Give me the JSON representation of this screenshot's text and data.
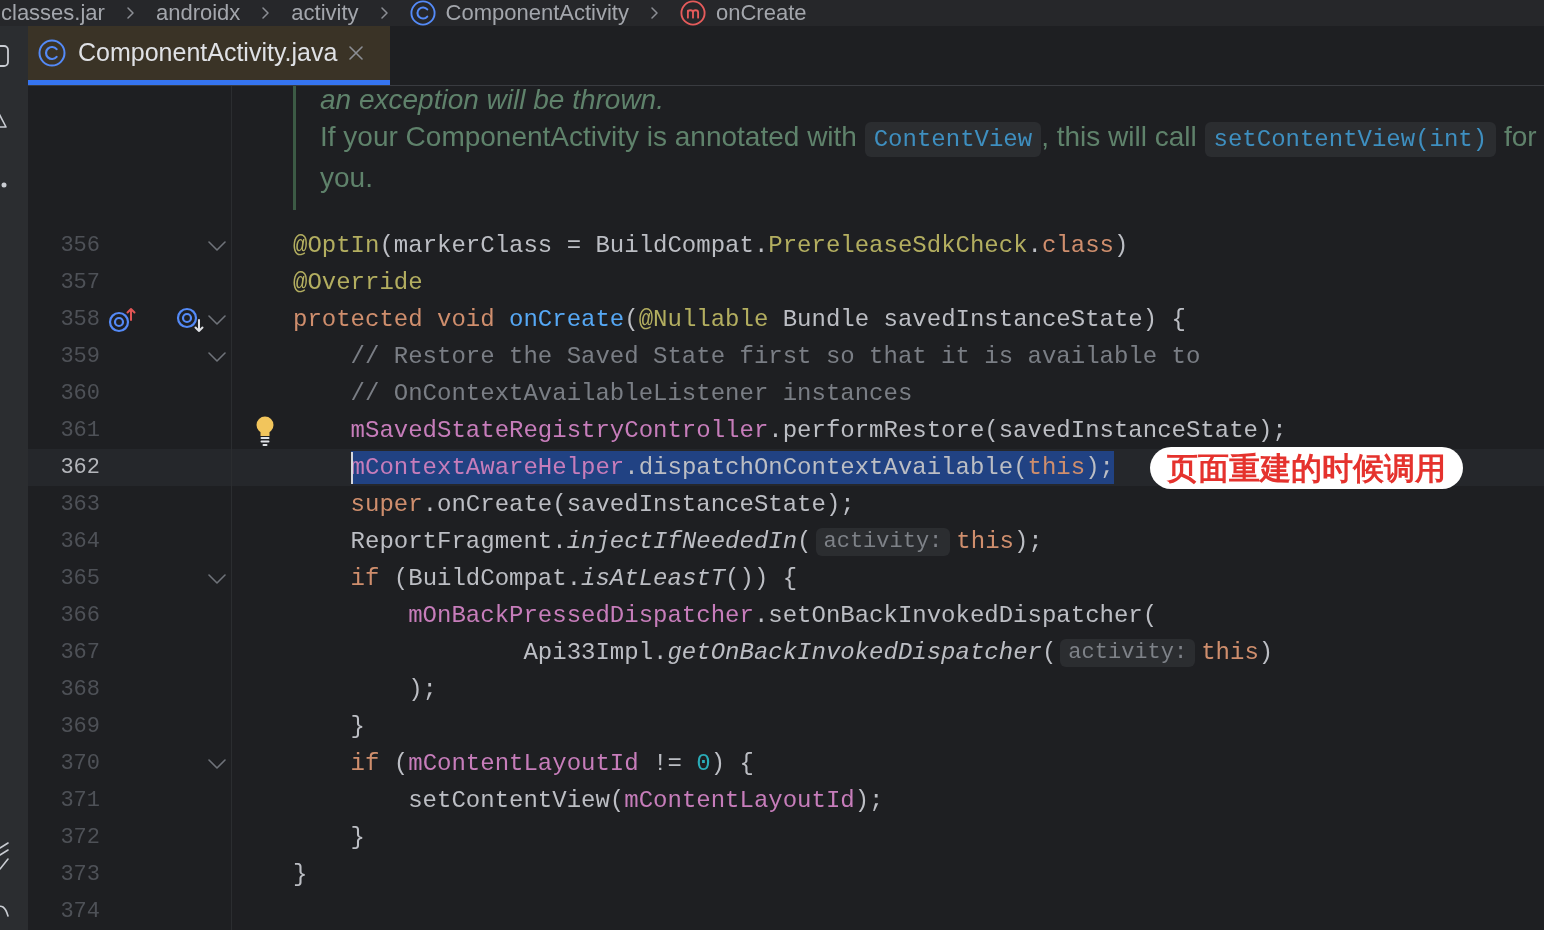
{
  "breadcrumbs": [
    {
      "label": "classes.jar",
      "kind": "plain"
    },
    {
      "label": "androidx",
      "kind": "plain"
    },
    {
      "label": "activity",
      "kind": "plain"
    },
    {
      "label": "ComponentActivity",
      "kind": "class"
    },
    {
      "label": "onCreate",
      "kind": "method"
    }
  ],
  "tabs": [
    {
      "label": "ComponentActivity.java",
      "kind": "class",
      "selected": true
    }
  ],
  "doc": {
    "fragment": "an exception will be thrown.",
    "paragraph": [
      {
        "kind": "text",
        "text": "If your ComponentActivity is annotated with "
      },
      {
        "kind": "code",
        "text": "ContentView"
      },
      {
        "kind": "text",
        "text": ", this will call "
      },
      {
        "kind": "code",
        "text": "setContentView(int)"
      },
      {
        "kind": "text",
        "text": " for you."
      }
    ]
  },
  "lines": [
    {
      "number": "356",
      "fold": true,
      "selected": false,
      "tokens": [
        {
          "text": "@OptIn",
          "kind": "annotation"
        },
        {
          "text": "(markerClass = BuildCompat.",
          "kind": "plain"
        },
        {
          "text": "PrereleaseSdkCheck",
          "kind": "annotation"
        },
        {
          "text": ".",
          "kind": "plain"
        },
        {
          "text": "class",
          "kind": "keyword"
        },
        {
          "text": ")",
          "kind": "plain"
        }
      ]
    },
    {
      "number": "357",
      "fold": false,
      "selected": false,
      "tokens": [
        {
          "text": "@Override",
          "kind": "annotation"
        }
      ]
    },
    {
      "number": "358",
      "fold": true,
      "selected": false,
      "markers": [
        {
          "kind": "ring-up"
        },
        {
          "kind": "ring-down"
        }
      ],
      "tokens": [
        {
          "text": "protected void ",
          "kind": "keyword"
        },
        {
          "text": "onCreate",
          "kind": "method"
        },
        {
          "text": "(",
          "kind": "plain"
        },
        {
          "text": "@Nullable",
          "kind": "annotation"
        },
        {
          "text": " Bundle savedInstanceState) {",
          "kind": "plain"
        }
      ]
    },
    {
      "number": "359",
      "fold": true,
      "selected": false,
      "tokens": [
        {
          "text": "    // Restore the Saved State first so that it is available to",
          "kind": "comment"
        }
      ]
    },
    {
      "number": "360",
      "fold": false,
      "selected": false,
      "tokens": [
        {
          "text": "    // OnContextAvailableListener instances",
          "kind": "comment"
        }
      ]
    },
    {
      "number": "361",
      "fold": false,
      "selected": false,
      "markers": [
        {
          "kind": "bulb"
        }
      ],
      "tokens": [
        {
          "text": "    mSavedStateRegistryController",
          "kind": "field"
        },
        {
          "text": ".performRestore(savedInstanceState);",
          "kind": "plain"
        }
      ]
    },
    {
      "number": "362",
      "fold": false,
      "selected": true,
      "callout": "页面重建的时候调用",
      "tokens": [
        {
          "text": "    mContextAwareHelper",
          "kind": "field"
        },
        {
          "text": ".dispatchOnContextAvailable(",
          "kind": "plain"
        },
        {
          "text": "this",
          "kind": "keyword"
        },
        {
          "text": ");",
          "kind": "plain"
        }
      ]
    },
    {
      "number": "363",
      "fold": false,
      "selected": false,
      "tokens": [
        {
          "text": "    super",
          "kind": "keyword"
        },
        {
          "text": ".onCreate(savedInstanceState);",
          "kind": "plain"
        }
      ]
    },
    {
      "number": "364",
      "fold": false,
      "selected": false,
      "tokens": [
        {
          "text": "    ReportFragment.",
          "kind": "plain"
        },
        {
          "text": "injectIfNeededIn",
          "kind": "static"
        },
        {
          "text": "(",
          "kind": "plain"
        },
        {
          "text": "activity:",
          "kind": "hint"
        },
        {
          "text": "this",
          "kind": "keyword"
        },
        {
          "text": ");",
          "kind": "plain"
        }
      ]
    },
    {
      "number": "365",
      "fold": true,
      "selected": false,
      "tokens": [
        {
          "text": "    if ",
          "kind": "keyword"
        },
        {
          "text": "(BuildCompat.",
          "kind": "plain"
        },
        {
          "text": "isAtLeastT",
          "kind": "static"
        },
        {
          "text": "()) {",
          "kind": "plain"
        }
      ]
    },
    {
      "number": "366",
      "fold": false,
      "selected": false,
      "tokens": [
        {
          "text": "        mOnBackPressedDispatcher",
          "kind": "field"
        },
        {
          "text": ".setOnBackInvokedDispatcher(",
          "kind": "plain"
        }
      ]
    },
    {
      "number": "367",
      "fold": false,
      "selected": false,
      "tokens": [
        {
          "text": "                Api33Impl.",
          "kind": "plain"
        },
        {
          "text": "getOnBackInvokedDispatcher",
          "kind": "static"
        },
        {
          "text": "(",
          "kind": "plain"
        },
        {
          "text": "activity:",
          "kind": "hint"
        },
        {
          "text": "this",
          "kind": "keyword"
        },
        {
          "text": ")",
          "kind": "plain"
        }
      ]
    },
    {
      "number": "368",
      "fold": false,
      "selected": false,
      "tokens": [
        {
          "text": "        );",
          "kind": "plain"
        }
      ]
    },
    {
      "number": "369",
      "fold": false,
      "selected": false,
      "tokens": [
        {
          "text": "    }",
          "kind": "plain"
        }
      ]
    },
    {
      "number": "370",
      "fold": true,
      "selected": false,
      "tokens": [
        {
          "text": "    if ",
          "kind": "keyword"
        },
        {
          "text": "(",
          "kind": "plain"
        },
        {
          "text": "mContentLayoutId",
          "kind": "field"
        },
        {
          "text": " != ",
          "kind": "plain"
        },
        {
          "text": "0",
          "kind": "number"
        },
        {
          "text": ") {",
          "kind": "plain"
        }
      ]
    },
    {
      "number": "371",
      "fold": false,
      "selected": false,
      "tokens": [
        {
          "text": "        setContentView(",
          "kind": "plain"
        },
        {
          "text": "mContentLayoutId",
          "kind": "field"
        },
        {
          "text": ");",
          "kind": "plain"
        }
      ]
    },
    {
      "number": "372",
      "fold": false,
      "selected": false,
      "tokens": [
        {
          "text": "    }",
          "kind": "plain"
        }
      ]
    },
    {
      "number": "373",
      "fold": false,
      "selected": false,
      "tokens": [
        {
          "text": "}",
          "kind": "plain"
        }
      ]
    },
    {
      "number": "374",
      "fold": false,
      "selected": false
    }
  ]
}
